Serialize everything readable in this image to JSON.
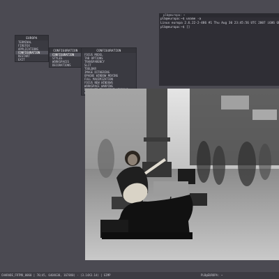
{
  "root_menu": {
    "title": "Europa",
    "items": [
      {
        "label": "Terminal"
      },
      {
        "label": "Firefox"
      },
      {
        "label": "Applications"
      },
      {
        "label": "Configuration"
      },
      {
        "label": "Restart"
      },
      {
        "label": "Exit"
      }
    ]
  },
  "config_menu": {
    "title": "Configuration",
    "items": [
      {
        "label": "Configuration"
      },
      {
        "label": "Styles"
      },
      {
        "label": "Workspaces"
      },
      {
        "label": "Decorations"
      }
    ]
  },
  "options_menu": {
    "title": "Configuration",
    "items": [
      {
        "label": "Focus Model"
      },
      {
        "label": "Tab Options"
      },
      {
        "label": "Transparency"
      },
      {
        "label": "Slit"
      },
      {
        "label": "Toolbar"
      },
      {
        "label": "Image Dithering"
      },
      {
        "label": "Opaque Window Moving"
      },
      {
        "label": "Full Maximization"
      },
      {
        "label": "Focus New Windows"
      },
      {
        "label": "Workspace Warping"
      },
      {
        "label": "Decorate Transient Windows"
      },
      {
        "label": "Click Raises"
      }
    ]
  },
  "terminal": {
    "title": "plb@europa: ~",
    "lines": [
      "plb@europa:~$ uname -a",
      "Linux europa 2.6.22-2-486 #1 Thu Aug 30 23:45:56 UTC 2007 i686 GNU/Linux",
      "plb@europa:~$ []"
    ]
  },
  "statusbar": {
    "left": "charade_frtmo_0060 | 76(45, 640x638, 1678x0) - (3.14x3.14) | gimp",
    "center": "plb@europa: ~"
  },
  "colors": {
    "desktop": "#4b4a52",
    "menu_bg": "#3a3a41",
    "menu_selected": "#56565f",
    "terminal_bg": "#2f2e35",
    "statusbar_bg": "#3d3c43"
  }
}
